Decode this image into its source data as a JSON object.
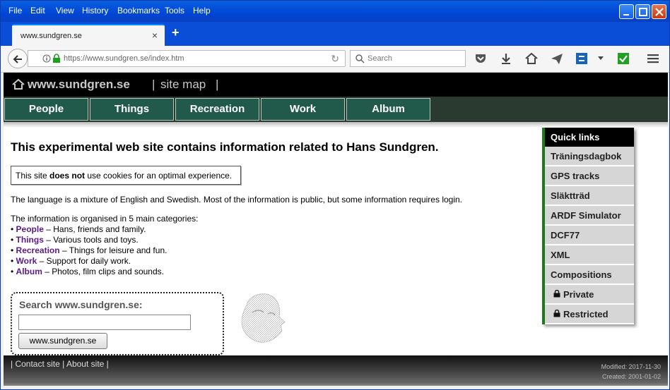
{
  "browser": {
    "menu": [
      "File",
      "Edit",
      "View",
      "History",
      "Bookmarks",
      "Tools",
      "Help"
    ],
    "tab_title": "www.sundgren.se",
    "url": "https://www.sundgren.se/index.htm",
    "search_placeholder": "Search"
  },
  "site": {
    "home_label": "www.sundgren.se",
    "sep1": "|",
    "site_map_label": "site map",
    "sep2": "|",
    "nav": [
      "People",
      "Things",
      "Recreation",
      "Work",
      "Album"
    ],
    "headline": "This experimental web site contains information related to Hans Sundgren.",
    "cookie_prefix": "This site ",
    "cookie_bold": "does not",
    "cookie_suffix": " use cookies for an optimal experience.",
    "language_para": "The language is a mixture of English and Swedish. Most of the information is public, but some information requires login.",
    "categories_intro": "The information is organised in 5 main categories:",
    "categories": [
      {
        "name": "People",
        "desc": " – Hans, friends and family."
      },
      {
        "name": "Things",
        "desc": " – Various tools and toys."
      },
      {
        "name": "Recreation",
        "desc": " – Things for leisure and fun."
      },
      {
        "name": "Work",
        "desc": " – Support for daily work."
      },
      {
        "name": "Album",
        "desc": " – Photos, film clips and sounds."
      }
    ],
    "search_label": "Search www.sundgren.se:",
    "search_button": "www.sundgren.se",
    "quick_links_header": "Quick links",
    "quick_links": [
      "Träningsdagbok",
      "GPS tracks",
      "Släktträd",
      "ARDF Simulator",
      "DCF77",
      "XML",
      "Compositions"
    ],
    "quick_links_locked": [
      "Private",
      "Restricted"
    ],
    "footer_contact": "Contact site",
    "footer_about": "About site",
    "modified": "Modified: 2017-11-30",
    "created": "Created: 2001-01-02"
  },
  "colors": {
    "titlebar": "#0046d6",
    "nav_button": "#21594a",
    "category_link": "#5b1a86",
    "quick_links_accent": "#1c7a1c"
  }
}
